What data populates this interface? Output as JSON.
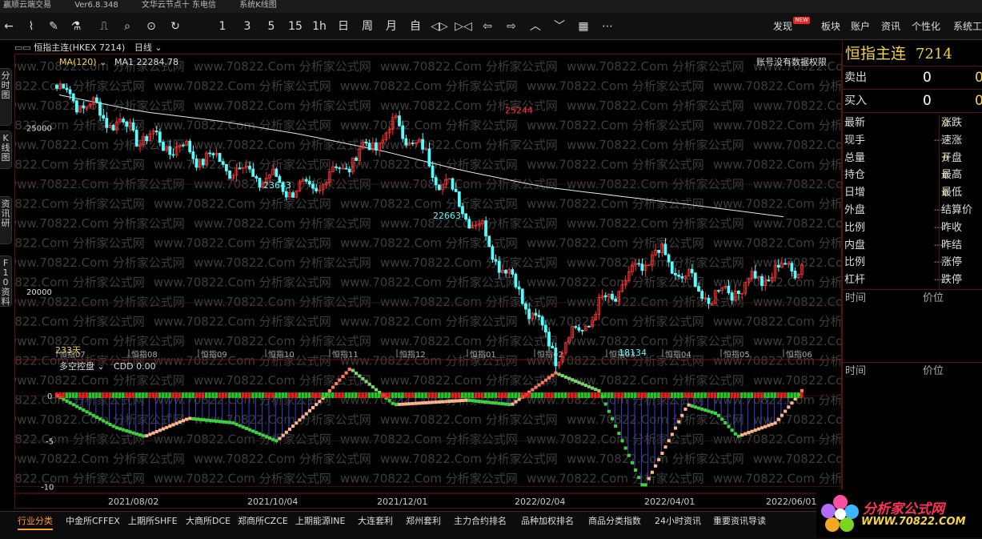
{
  "titlebar": {
    "app": "赢顺云端交易",
    "version": "Ver6.8.348",
    "news": "文华云节点十 东电信",
    "view": "系统K线图"
  },
  "toolbar": {
    "icons": [
      "back-arrow-icon",
      "line-chart-icon",
      "draw-icon",
      "indicator-icon",
      "chart-switch-icon",
      "magnify-icon",
      "lock-icon",
      "refresh-icon"
    ],
    "periods": [
      "1",
      "3",
      "5",
      "15",
      "1h",
      "日",
      "周",
      "月",
      "自"
    ],
    "menus": {
      "discover": "发现",
      "new_badge": "NEW",
      "sector": "板块",
      "account": "账户",
      "info": "资讯",
      "personalize": "个性化",
      "system": "系统工"
    }
  },
  "sidebar": {
    "tabs": [
      "分时图",
      "K线图",
      "资讯研",
      "F10资料"
    ]
  },
  "chart": {
    "symbol": "恒指主连(HKEX 7214)",
    "period": "日线",
    "ma_label": "MA(120)",
    "ma_value": "MA1 22284.78",
    "permission": "账号没有数据权限",
    "y_ticks": [
      "25000",
      "20000"
    ],
    "sub_y_ticks": [
      "0",
      "-5",
      "-10"
    ],
    "x_labels": [
      "恒指07",
      "恒指08",
      "恒指09",
      "恒指10",
      "恒指11",
      "恒指12",
      "恒指01",
      "恒指02",
      "恒指03",
      "恒指04",
      "恒指05",
      "恒指06"
    ],
    "dates": [
      "2021/08/02",
      "2021/10/04",
      "2021/12/01",
      "2022/02/04",
      "2022/04/01",
      "2022/06/01"
    ],
    "annotations": {
      "high1": "25244",
      "low1": "23643",
      "low2": "22663",
      "low3": "18134",
      "days": "233天"
    },
    "sub_indicator": "多空控盘",
    "sub_value": "CDD 0.00",
    "watermark": "www.70822.Com 分析家公式网"
  },
  "chart_data": {
    "type": "candlestick",
    "title": "恒指主连(HKEX 7214) 日线",
    "x": [
      "2021/08/02",
      "2021/10/04",
      "2021/12/01",
      "2022/02/04",
      "2022/04/01",
      "2022/06/01"
    ],
    "close_trend": [
      26200,
      24800,
      23900,
      23000,
      25100,
      21800,
      18134,
      21200,
      19800,
      20900
    ],
    "ma120_trend": [
      26000,
      25500,
      25200,
      24800,
      24300,
      23700,
      23200,
      22900,
      22600,
      22284.78
    ],
    "marked_points": [
      {
        "label": "25244",
        "value": 25244
      },
      {
        "label": "23643",
        "value": 23643
      },
      {
        "label": "22663",
        "value": 22663
      },
      {
        "label": "18134",
        "value": 18134
      }
    ],
    "ylim": [
      18000,
      26500
    ],
    "y_ticks": [
      20000,
      25000
    ],
    "sub": {
      "name": "多空控盘",
      "CDD": 0.0,
      "ylim": [
        -10.5,
        3
      ],
      "ticks": [
        0,
        -5,
        -10
      ]
    }
  },
  "right_panel": {
    "name": "恒指主连",
    "code": "7214",
    "sell_label": "卖出",
    "sell_value": "0",
    "buy_label": "买入",
    "buy_value": "0",
    "quotes": [
      {
        "l": "最新",
        "v": "0",
        "r": "涨跌"
      },
      {
        "l": "现手",
        "v": "-----",
        "r": "速涨"
      },
      {
        "l": "总量",
        "v": "0",
        "r": "开盘"
      },
      {
        "l": "持仓",
        "v": "0",
        "r": "最高"
      },
      {
        "l": "日增",
        "v": "0",
        "r": "最低"
      },
      {
        "l": "外盘",
        "v": "-----",
        "r": "结算价"
      },
      {
        "l": "比例",
        "v": "-----",
        "r": "昨收"
      },
      {
        "l": "内盘",
        "v": "-----",
        "r": "昨结"
      },
      {
        "l": "比例",
        "v": "-----",
        "r": "涨停"
      },
      {
        "l": "杠杆",
        "v": "-----",
        "r": "跌停"
      }
    ],
    "ticks1": {
      "time": "时间",
      "price": "价位"
    },
    "ticks2": {
      "time": "时间",
      "price": "价位"
    }
  },
  "bottom_tabs": [
    "行业分类",
    "中金所CFFEX",
    "上期所SHFE",
    "大商所DCE",
    "郑商所CZCE",
    "上期能源INE",
    "大连套利",
    "郑州套利",
    "主力合约排名",
    "品种加权排名",
    "商品分类指数",
    "24小时资讯",
    "重要资讯导读"
  ],
  "logo": {
    "text": "分析家公式网",
    "url": "WWW.70822.COM"
  }
}
